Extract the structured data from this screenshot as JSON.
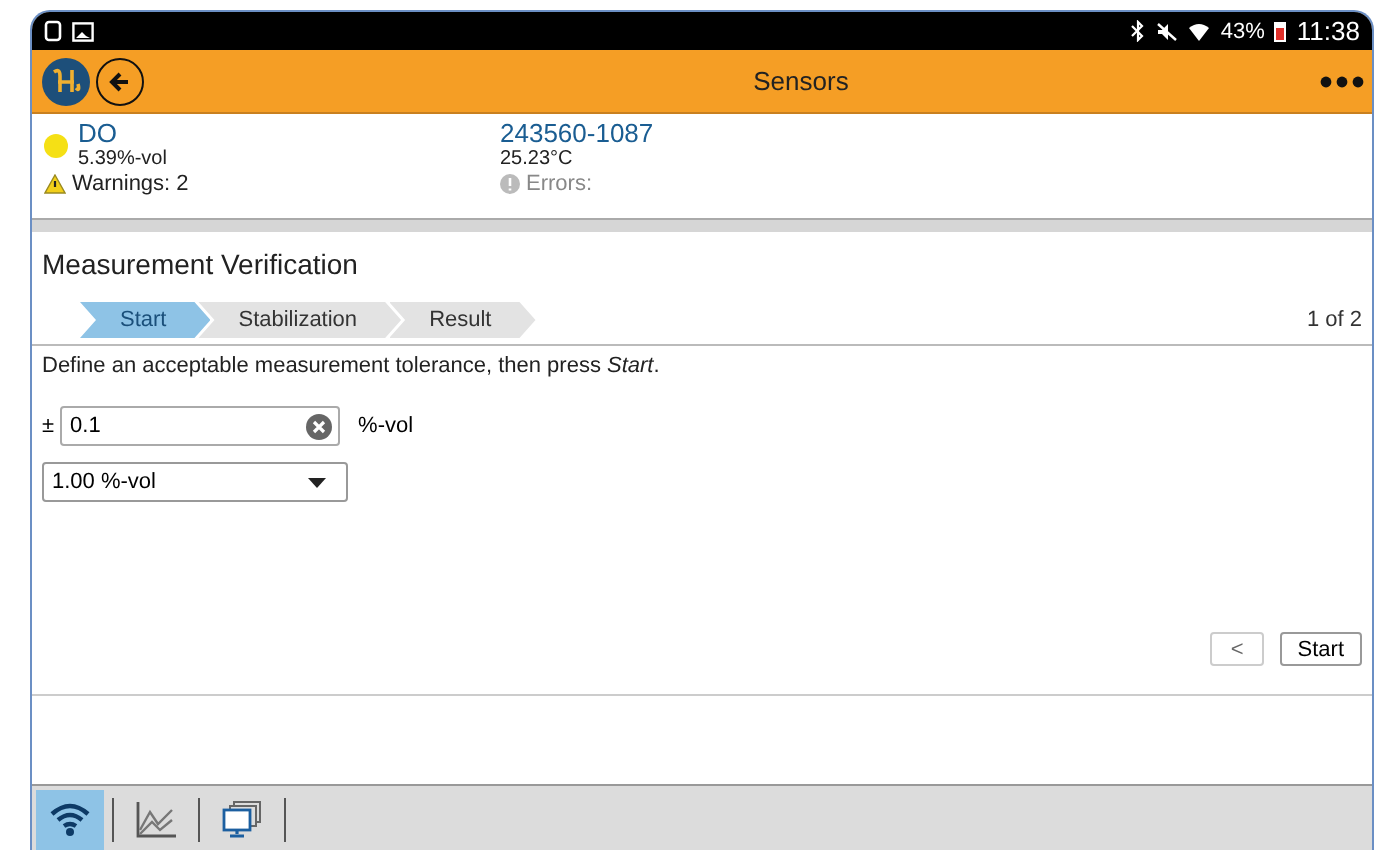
{
  "status_bar": {
    "battery": "43%",
    "time": "11:38"
  },
  "app_bar": {
    "title": "Sensors"
  },
  "sensor": {
    "name": "DO",
    "reading": "5.39%-vol",
    "warnings": "Warnings: 2",
    "serial": "243560-1087",
    "temperature": "25.23°C",
    "errors": "Errors:",
    "color": "#f5e015"
  },
  "page": {
    "title": "Measurement Verification",
    "page_count": "1 of 2",
    "steps": [
      {
        "label": "Start",
        "selected": true
      },
      {
        "label": "Stabilization",
        "selected": false
      },
      {
        "label": "Result",
        "selected": false
      }
    ],
    "instruction": "Define an acceptable measurement tolerance, then press *Start*.",
    "tolerance": {
      "prefix": "±",
      "value": "0.1",
      "unit": "%-vol"
    },
    "dropdown": {
      "value": "1.00 %-vol"
    },
    "buttons": {
      "back": "<",
      "next": "Start"
    }
  },
  "bottom_tabs": [
    {
      "kind": "wifi",
      "selected": true
    },
    {
      "kind": "chart",
      "selected": false
    },
    {
      "kind": "monitor",
      "selected": false
    }
  ]
}
